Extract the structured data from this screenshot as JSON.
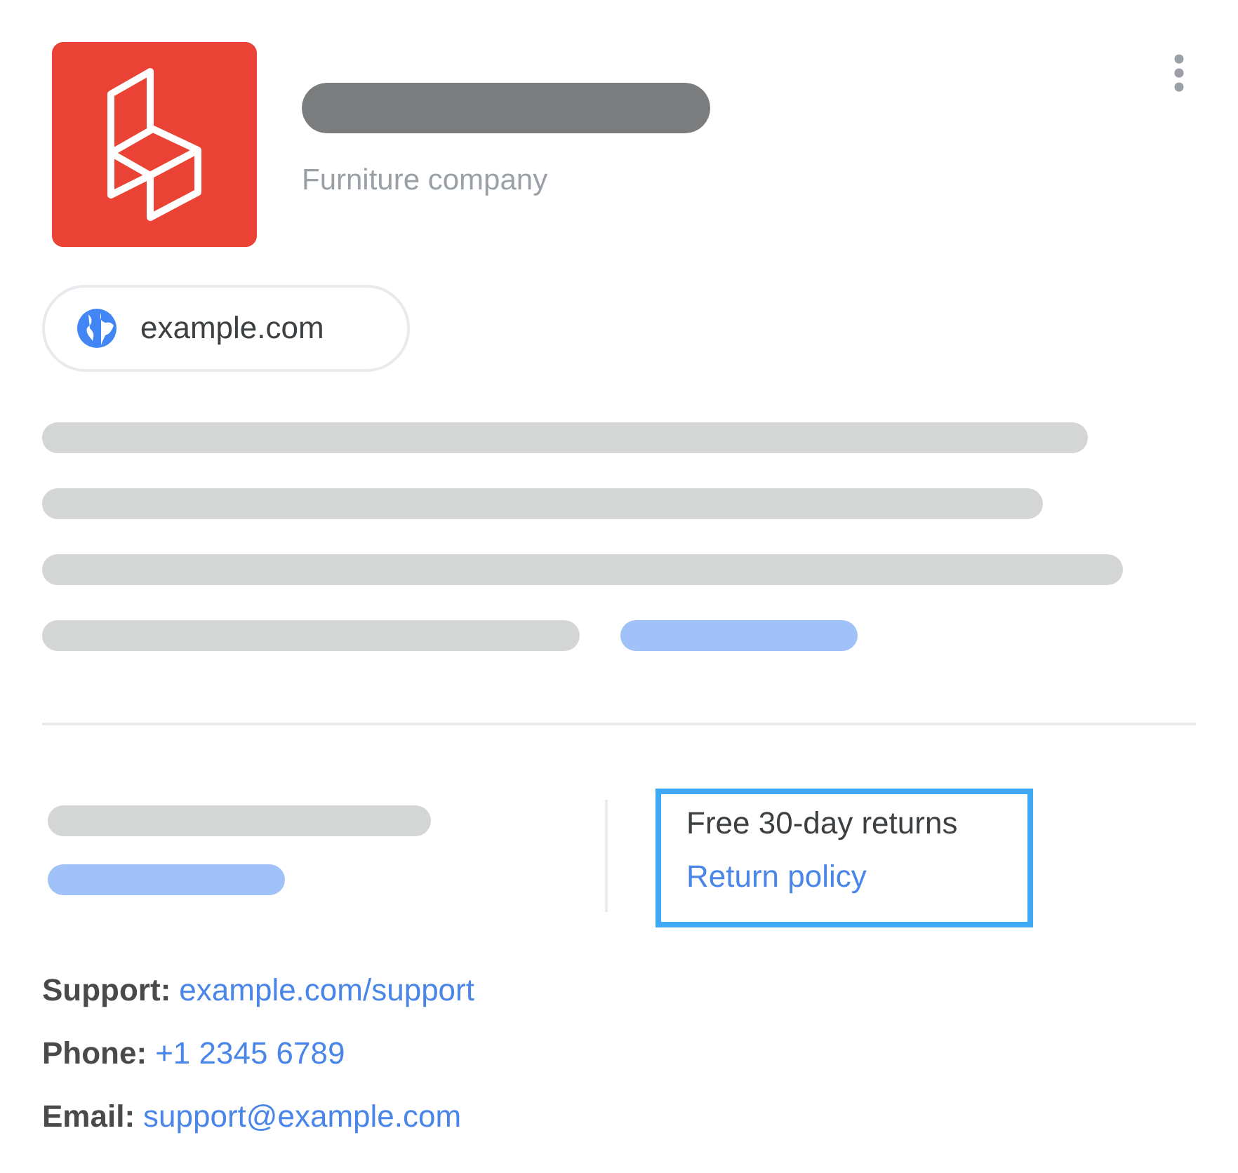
{
  "category": "Furniture company",
  "website_chip": {
    "label": "example.com"
  },
  "returns": {
    "label": "Free 30-day returns",
    "link": "Return policy"
  },
  "contacts": [
    {
      "label": "Support:",
      "value": "example.com/support"
    },
    {
      "label": "Phone:",
      "value": "+1 2345 6789"
    },
    {
      "label": "Email:",
      "value": "support@example.com"
    }
  ]
}
